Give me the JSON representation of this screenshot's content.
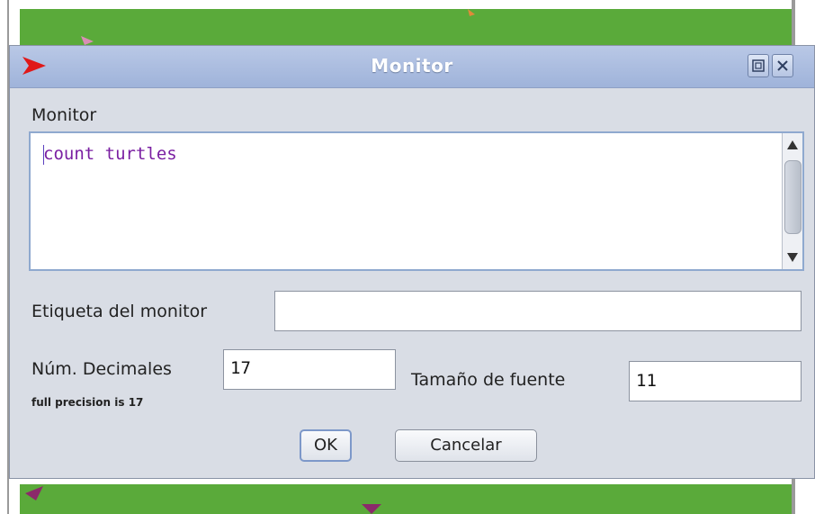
{
  "window": {
    "title": "Monitor",
    "buttons": {
      "maximize_icon": "maximize-icon",
      "close_icon": "close-icon"
    }
  },
  "reporter": {
    "label": "Monitor",
    "code": "count turtles"
  },
  "display_name": {
    "label": "Etiqueta del monitor",
    "value": ""
  },
  "decimals": {
    "label": "Núm. Decimales",
    "value": "17",
    "hint": "full precision is 17"
  },
  "font_size": {
    "label": "Tamaño de fuente",
    "value": "11"
  },
  "actions": {
    "ok_label": "OK",
    "cancel_label": "Cancelar"
  },
  "colors": {
    "titlebar": "#9fb3da",
    "dialog_bg": "#d9dde5",
    "code_text": "#7a1fa2",
    "world_green": "#5aaa3a"
  }
}
